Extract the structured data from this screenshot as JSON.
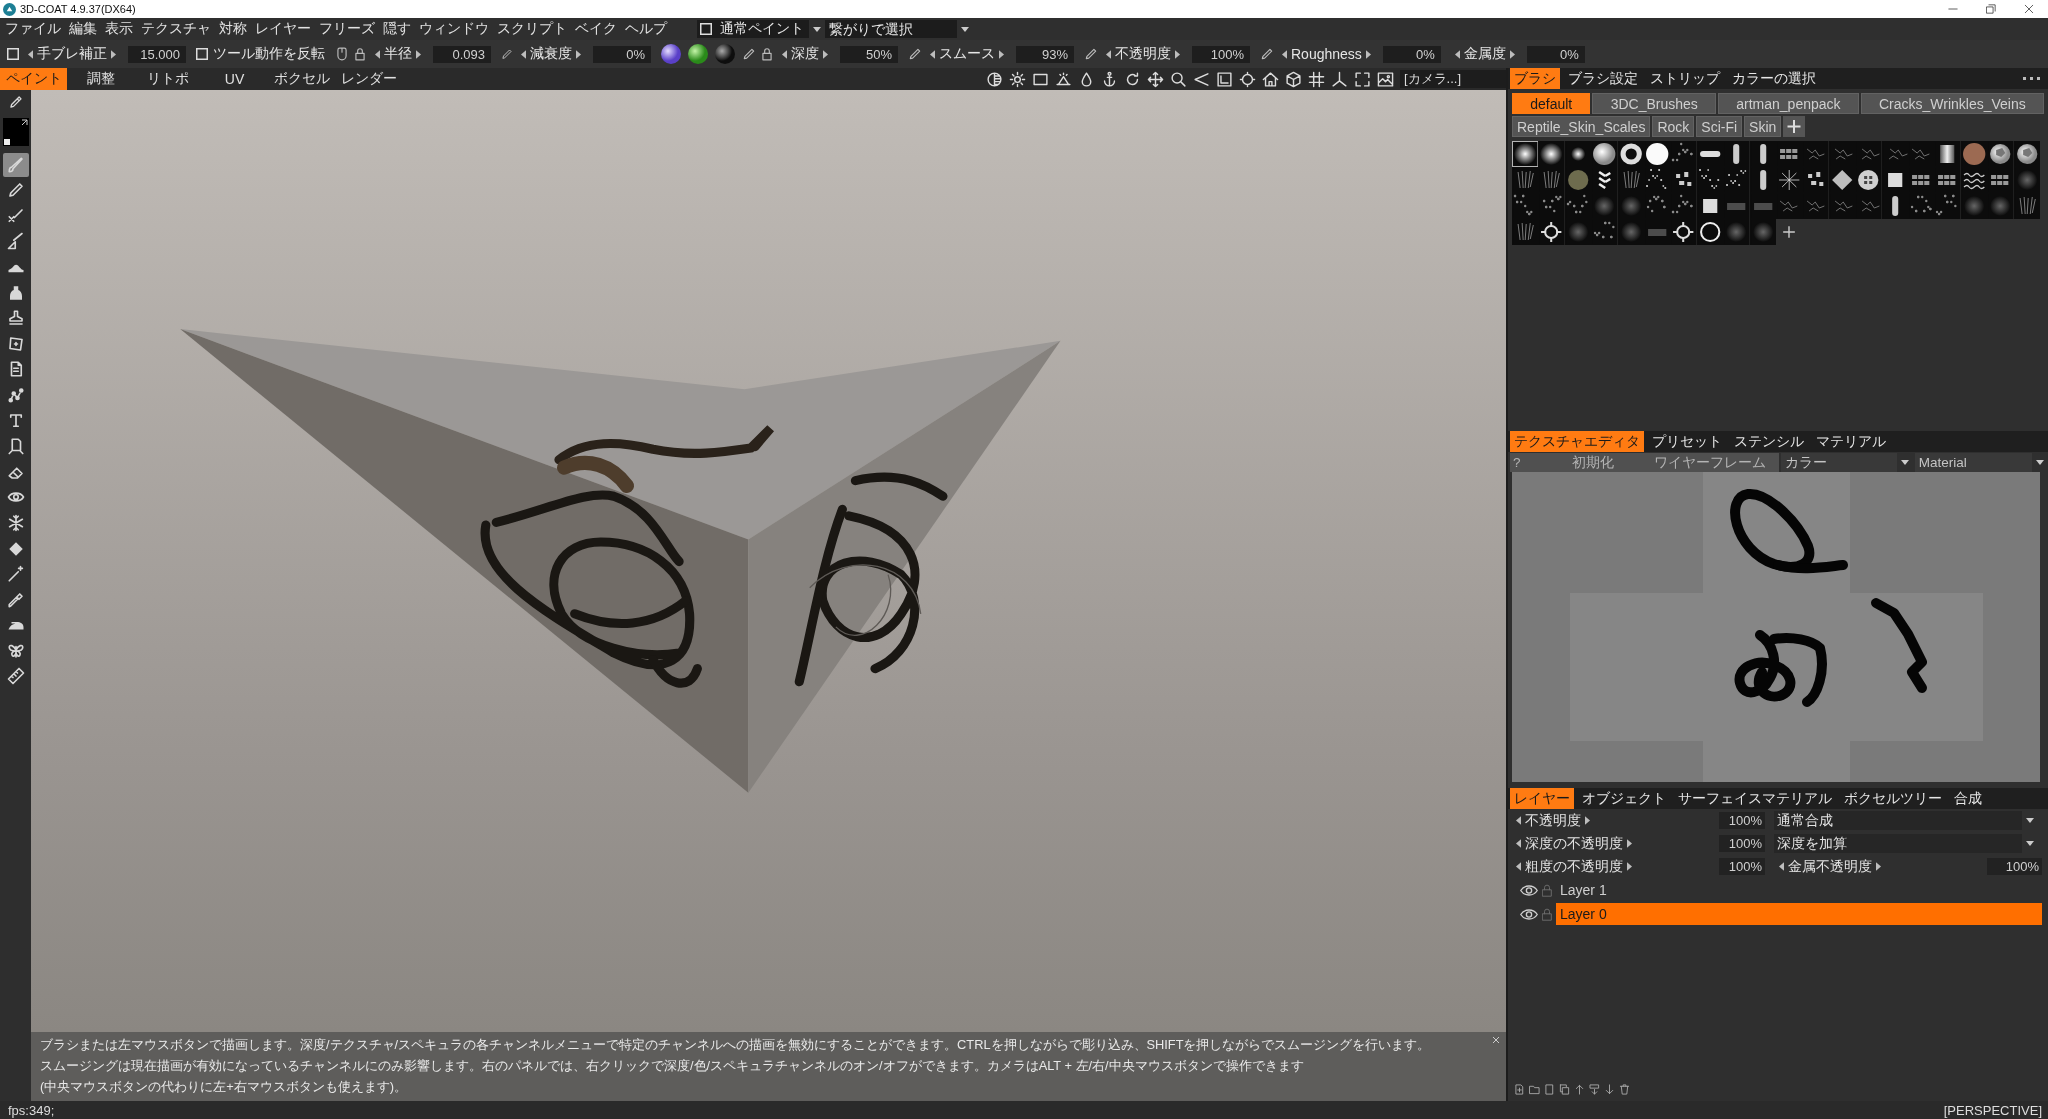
{
  "window": {
    "title": "3D-COAT 4.9.37(DX64)"
  },
  "menu_bar": {
    "items": [
      "ファイル",
      "編集",
      "表示",
      "テクスチャ",
      "対称",
      "レイヤー",
      "フリーズ",
      "隠す",
      "ウィンドウ",
      "スクリプト",
      "ベイク",
      "ヘルプ"
    ],
    "paint_mode": {
      "label": "通常ペイント",
      "checked": false
    },
    "selection_mode": "繋がりで選択"
  },
  "tool_options": [
    {
      "kind": "check_stepper",
      "checked": false,
      "label": "手ブレ補正",
      "value": "15.000"
    },
    {
      "kind": "checkbox",
      "checked": false,
      "label": "ツール動作を反転"
    },
    {
      "kind": "stepper",
      "label": "半径",
      "value": "0.093"
    },
    {
      "kind": "stepper",
      "label": "減衰度",
      "value": "0%"
    },
    {
      "kind": "stepper",
      "label": "深度",
      "value": "50%"
    },
    {
      "kind": "stepper",
      "label": "スムース",
      "value": "93%"
    },
    {
      "kind": "stepper",
      "label": "不透明度",
      "value": "100%"
    },
    {
      "kind": "stepper",
      "label": "Roughness",
      "value": "0%"
    },
    {
      "kind": "stepper",
      "label": "金属度",
      "value": "0%"
    }
  ],
  "mode_tabs": [
    {
      "label": "ペイント",
      "selected": true
    },
    {
      "label": "調整",
      "selected": false
    },
    {
      "label": "リトポ",
      "selected": false
    },
    {
      "label": "UV",
      "selected": false
    },
    {
      "label": "ボクセル",
      "selected": false
    },
    {
      "label": "レンダー",
      "selected": false
    }
  ],
  "camera_field": {
    "value": "[カメラ...]"
  },
  "tools": [
    {
      "selected": false
    },
    {
      "selected": true
    },
    {
      "selected": false
    },
    {
      "selected": false
    },
    {
      "selected": false
    },
    {
      "selected": false
    },
    {
      "selected": false
    },
    {
      "selected": false
    },
    {
      "selected": false
    },
    {
      "selected": false
    },
    {
      "selected": false
    },
    {
      "selected": false
    },
    {
      "selected": false
    },
    {
      "selected": false
    },
    {
      "selected": false
    },
    {
      "selected": false
    },
    {
      "selected": false
    },
    {
      "selected": false
    },
    {
      "selected": false
    },
    {
      "selected": false
    },
    {
      "selected": false
    },
    {
      "selected": false
    }
  ],
  "hint": {
    "lines": [
      "ブラシまたは左マウスボタンで描画します。深度/テクスチャ/スペキュラの各チャンネルメニューで特定のチャンネルへの描画を無効にすることができます。CTRLを押しながらで彫り込み、SHIFTを押しながらでスムージングを行います。",
      "スムージングは現在描画が有効になっているチャンネルにのみ影響します。右のパネルでは、右クリックで深度/色/スペキュラチャンネルのオン/オフができます。カメラはALT + 左/右/中央マウスボタンで操作できます",
      "(中央マウスボタンの代わりに左+右マウスボタンも使えます)。"
    ]
  },
  "brush_panel": {
    "tabs": [
      {
        "label": "ブラシ",
        "selected": true
      },
      {
        "label": "ブラシ設定",
        "selected": false
      },
      {
        "label": "ストリップ",
        "selected": false
      },
      {
        "label": "カラーの選択",
        "selected": false
      }
    ],
    "pack_rows": [
      [
        {
          "label": "default",
          "selected": true
        },
        {
          "label": "3DC_Brushes",
          "selected": false
        },
        {
          "label": "artman_penpack",
          "selected": false
        },
        {
          "label": "Cracks_Wrinkles_Veins",
          "selected": false
        }
      ],
      [
        {
          "label": "Reptile_Skin_Scales",
          "selected": false
        },
        {
          "label": "Rock",
          "selected": false
        },
        {
          "label": "Sci-Fi",
          "selected": false
        },
        {
          "label": "Skin",
          "selected": false
        }
      ]
    ],
    "brushes": [
      {
        "selected": true
      },
      {
        "selected": false
      },
      {
        "selected": false
      },
      {
        "selected": false
      },
      {
        "selected": false
      },
      {
        "selected": false
      },
      {
        "selected": false
      },
      {
        "selected": false
      },
      {
        "selected": false
      },
      {
        "selected": false
      },
      {
        "selected": false
      },
      {
        "selected": false
      },
      {
        "selected": false
      },
      {
        "selected": false
      },
      {
        "selected": false
      },
      {
        "selected": false
      },
      {
        "selected": false
      },
      {
        "selected": false
      },
      {
        "selected": false
      },
      {
        "selected": false
      },
      {
        "selected": false
      },
      {
        "selected": false
      },
      {
        "selected": false
      },
      {
        "selected": false
      },
      {
        "selected": false
      },
      {
        "selected": false
      },
      {
        "selected": false
      },
      {
        "selected": false
      },
      {
        "selected": false
      },
      {
        "selected": false
      },
      {
        "selected": false
      },
      {
        "selected": false
      },
      {
        "selected": false
      },
      {
        "selected": false
      },
      {
        "selected": false
      },
      {
        "selected": false
      },
      {
        "selected": false
      },
      {
        "selected": false
      },
      {
        "selected": false
      },
      {
        "selected": false
      },
      {
        "selected": false
      },
      {
        "selected": false
      },
      {
        "selected": false
      },
      {
        "selected": false
      },
      {
        "selected": false
      },
      {
        "selected": false
      },
      {
        "selected": false
      },
      {
        "selected": false
      },
      {
        "selected": false
      },
      {
        "selected": false
      },
      {
        "selected": false
      },
      {
        "selected": false
      },
      {
        "selected": false
      },
      {
        "selected": false
      },
      {
        "selected": false
      },
      {
        "selected": false
      },
      {
        "selected": false
      },
      {
        "selected": false
      },
      {
        "selected": false
      },
      {
        "selected": false
      },
      {
        "selected": false
      },
      {
        "selected": false
      },
      {
        "selected": false
      },
      {
        "selected": false
      },
      {
        "selected": false
      },
      {
        "selected": false
      },
      {
        "selected": false
      },
      {
        "selected": false
      },
      {
        "selected": false
      },
      {
        "selected": false
      }
    ]
  },
  "texture_editor": {
    "tabs": [
      {
        "label": "テクスチャエディタ",
        "selected": true
      },
      {
        "label": "プリセット",
        "selected": false
      },
      {
        "label": "ステンシル",
        "selected": false
      },
      {
        "label": "マテリアル",
        "selected": false
      }
    ],
    "buttons": [
      "?",
      "初期化",
      "ワイヤーフレーム"
    ],
    "channel": "カラー",
    "material": "Material"
  },
  "layers_panel": {
    "tabs": [
      {
        "label": "レイヤー",
        "selected": true
      },
      {
        "label": "オブジェクト",
        "selected": false
      },
      {
        "label": "サーフェイスマテリアル",
        "selected": false
      },
      {
        "label": "ボクセルツリー",
        "selected": false
      },
      {
        "label": "合成",
        "selected": false
      }
    ],
    "properties": [
      {
        "kind": "blend",
        "label": "不透明度",
        "value": "100%",
        "blend": "通常合成"
      },
      {
        "kind": "blend",
        "label": "深度の不透明度",
        "value": "100%",
        "blend": "深度を加算"
      },
      {
        "kind": "pair",
        "label": "粗度の不透明度",
        "value": "100%",
        "extra_label": "金属不透明度",
        "extra_value": "100%"
      }
    ],
    "layers": [
      {
        "name": "Layer 1",
        "visible": true,
        "locked": false,
        "selected": false
      },
      {
        "name": "Layer 0",
        "visible": true,
        "locked": false,
        "selected": true
      }
    ]
  },
  "status_bar": {
    "fps": "fps:349;",
    "view": "[PERSPECTIVE]"
  }
}
